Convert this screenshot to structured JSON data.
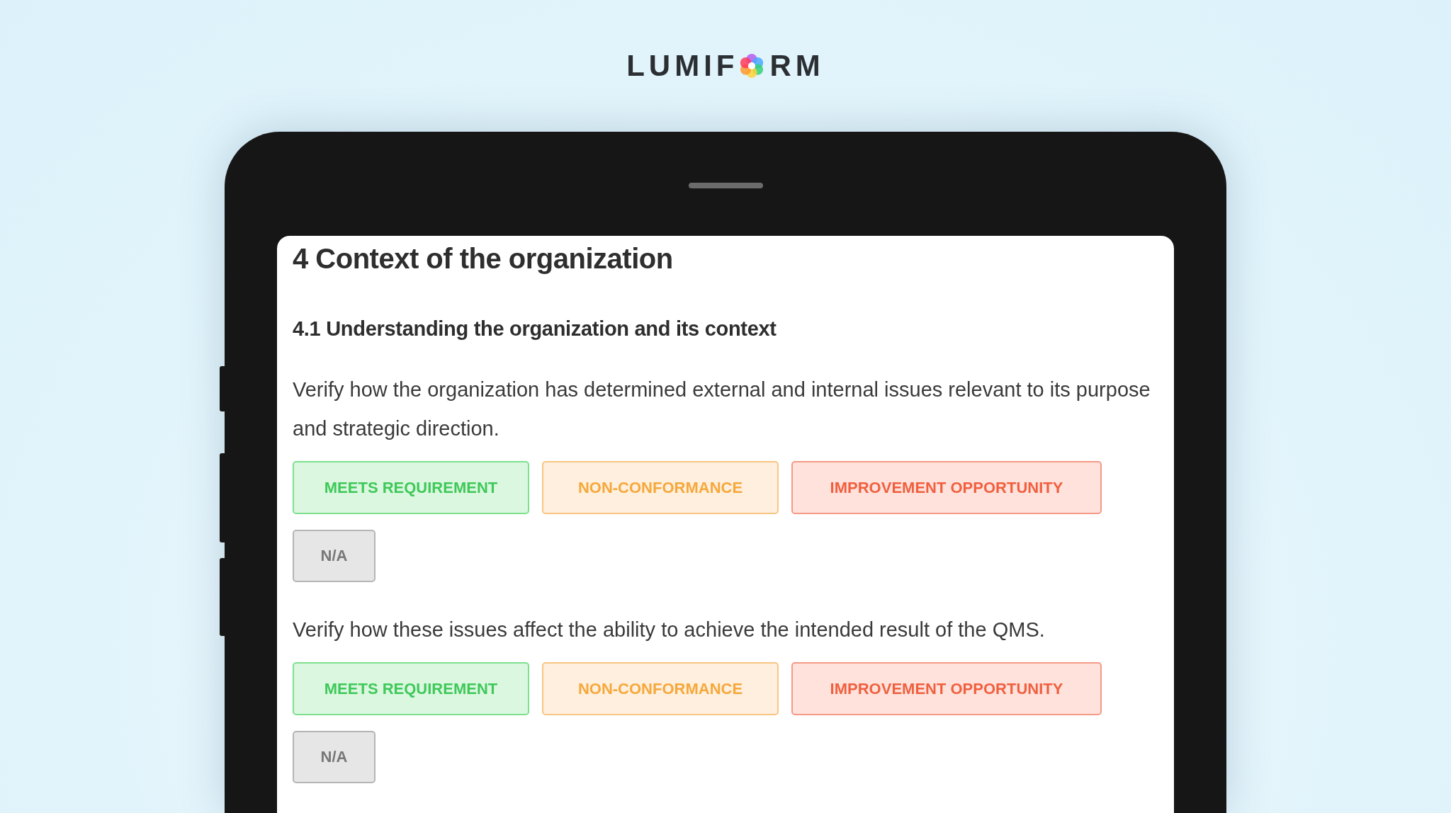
{
  "logo": {
    "before": "LUMIF",
    "after": "RM"
  },
  "screen": {
    "title": "4 Context of the organization",
    "section": "4.1 Understanding the organization and its context",
    "questions": [
      {
        "text": "Verify how the organization has determined external and internal issues relevant to its purpose and strategic direction.",
        "options": [
          {
            "label": "MEETS REQUIREMENT",
            "kind": "meets"
          },
          {
            "label": "NON-CONFORMANCE",
            "kind": "nonconformance"
          },
          {
            "label": "IMPROVEMENT OPPORTUNITY",
            "kind": "improvement"
          },
          {
            "label": "N/A",
            "kind": "na"
          }
        ]
      },
      {
        "text": "Verify how these issues affect the ability to achieve the intended result of the QMS.",
        "options": [
          {
            "label": "MEETS REQUIREMENT",
            "kind": "meets"
          },
          {
            "label": "NON-CONFORMANCE",
            "kind": "nonconformance"
          },
          {
            "label": "IMPROVEMENT OPPORTUNITY",
            "kind": "improvement"
          },
          {
            "label": "N/A",
            "kind": "na"
          }
        ]
      }
    ]
  }
}
